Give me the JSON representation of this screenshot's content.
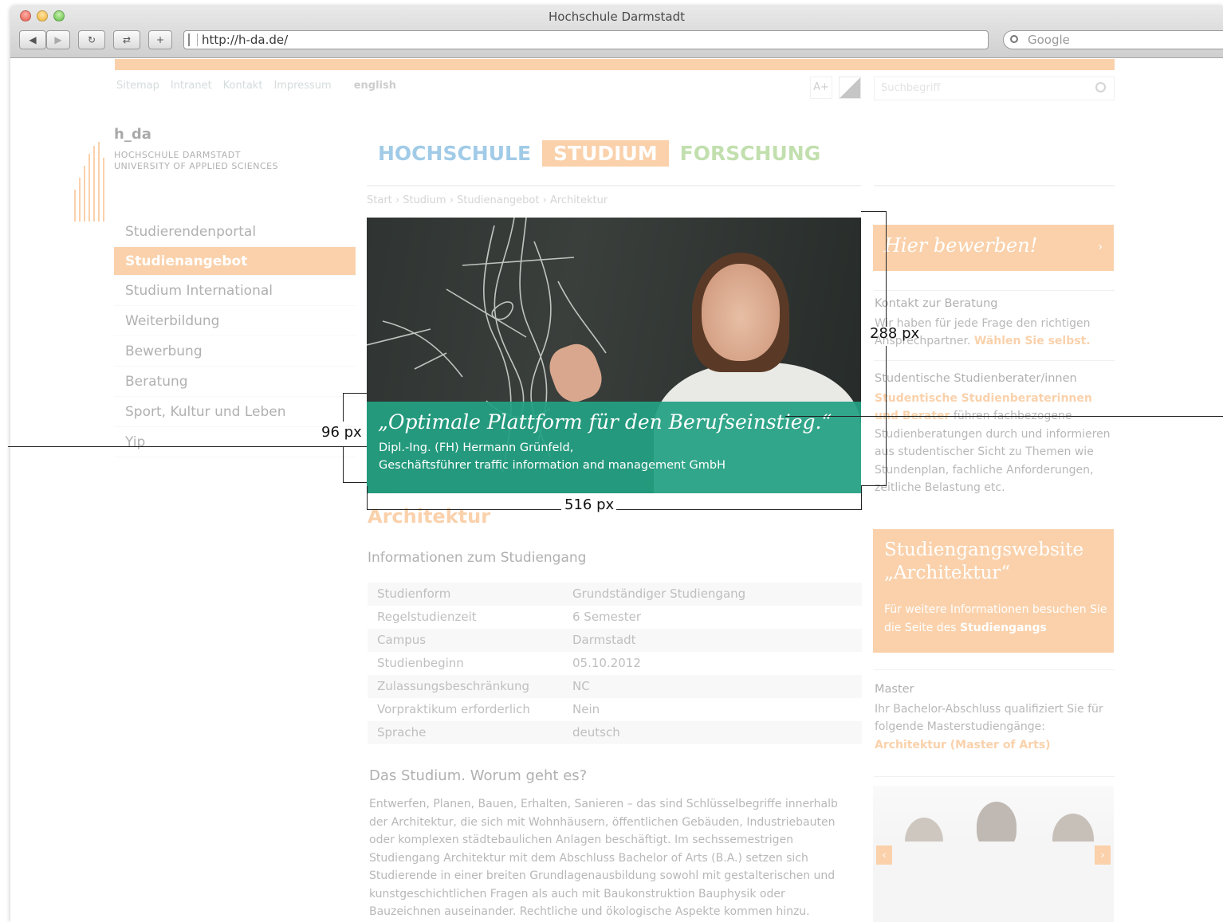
{
  "browser": {
    "title": "Hochschule Darmstadt",
    "url": "http://h-da.de/",
    "search_placeholder": "Google"
  },
  "top_links": [
    "Sitemap",
    "Intranet",
    "Kontakt",
    "Impressum"
  ],
  "language_link": "english",
  "font_size_button": "A+",
  "site_search_placeholder": "Suchbegriff",
  "logo": {
    "name": "h_da",
    "line1": "HOCHSCHULE DARMSTADT",
    "line2": "UNIVERSITY OF APPLIED SCIENCES"
  },
  "main_nav": {
    "hochschule": "HOCHSCHULE",
    "studium": "STUDIUM",
    "forschung": "FORSCHUNG"
  },
  "breadcrumb": "Start  ›  Studium  ›  Studienangebot  ›  Architektur",
  "sidebar": {
    "items": [
      {
        "label": "Studierendenportal"
      },
      {
        "label": "Studienangebot"
      },
      {
        "label": "Studium International"
      },
      {
        "label": "Weiterbildung"
      },
      {
        "label": "Bewerbung"
      },
      {
        "label": "Beratung"
      },
      {
        "label": "Sport, Kultur und Leben"
      },
      {
        "label": "Yip"
      }
    ],
    "active_index": 1
  },
  "hero": {
    "quote": "„Optimale Plattform für den Berufseinstieg.“",
    "author_line1": "Dipl.-Ing. (FH) Hermann Grünfeld,",
    "author_line2": "Geschäftsführer traffic information and management GmbH"
  },
  "annotations": {
    "width": "516 px",
    "height_image": "288 px",
    "height_caption": "96 px"
  },
  "content": {
    "title": "Architektur",
    "info_heading": "Informationen zum Studiengang",
    "info_rows": [
      {
        "key": "Studienform",
        "value": "Grundständiger Studiengang"
      },
      {
        "key": "Regelstudienzeit",
        "value": "6 Semester"
      },
      {
        "key": "Campus",
        "value": "Darmstadt"
      },
      {
        "key": "Studienbeginn",
        "value": "05.10.2012"
      },
      {
        "key": "Zulassungsbeschränkung",
        "value": "NC"
      },
      {
        "key": "Vorpraktikum erforderlich",
        "value": "Nein"
      },
      {
        "key": "Sprache",
        "value": "deutsch"
      }
    ],
    "study_heading": "Das Studium. Worum geht es?",
    "study_text": "Entwerfen, Planen, Bauen, Erhalten, Sanieren – das sind Schlüsselbegriffe innerhalb der Architektur, die sich mit Wohnhäusern, öffentlichen Gebäuden, Industriebauten oder komplexen städtebaulichen Anlagen beschäftigt. Im sechssemestrigen Studiengang Architektur mit dem Abschluss Bachelor of Arts (B.A.) setzen sich Studierende in einer breiten Grundlagenausbildung sowohl mit gestalterischen und kunstgeschichtlichen Fragen als auch mit Baukonstruktion Bauphysik oder Bauzeichnen auseinander. Rechtliche und ökologische Aspekte kommen hinzu. Daneben werden die angehenden Architektinnen und Architekten auch befähigt"
  },
  "right": {
    "apply": "Hier bewerben!",
    "kontakt_title": "Kontakt zur Beratung",
    "kontakt_text": "Wir haben für jede Frage den richtigen Ansprechpartner.",
    "kontakt_link": "Wählen Sie selbst.",
    "studberater_title": "Studentische Studienberater/innen",
    "studberater_link": "Studentische Studienberaterinnen und Berater",
    "studberater_text": "führen fachbezogene Studienberatungen durch und informieren aus studentischer Sicht zu Themen wie Stundenplan, fachliche Anforderungen, zeitliche Belastung etc.",
    "website_title": "Studiengangswebsite „Architektur“",
    "website_text": "Für weitere Informationen besuchen Sie die Seite des",
    "website_link": "Studiengangs",
    "master_title": "Master",
    "master_text": "Ihr Bachelor-Abschluss qualifiziert Sie für folgende Masterstudiengänge:",
    "master_link": "Architektur (Master of Arts)"
  },
  "colors": {
    "accent_orange": "#f39237",
    "teal": "#24a082",
    "blue": "#1f84c7",
    "green": "#6fb43f"
  }
}
